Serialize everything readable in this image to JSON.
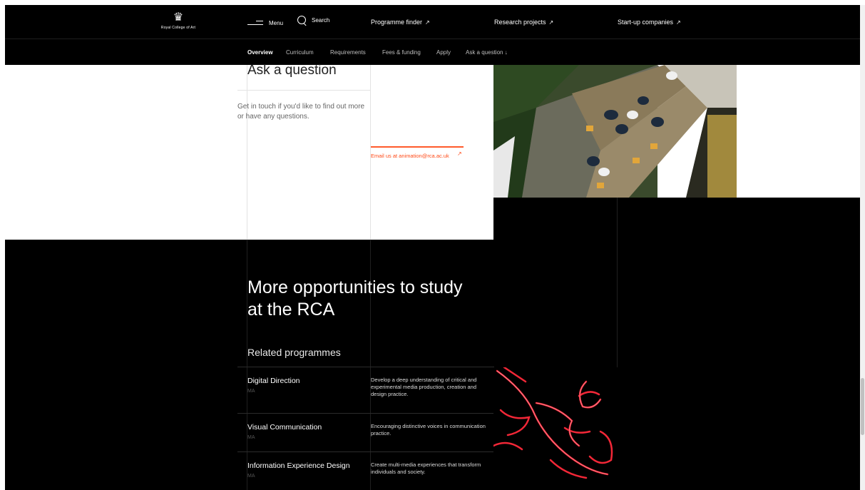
{
  "header": {
    "logo_text": "Royal College of Art",
    "menu_label": "Menu",
    "search_label": "Search",
    "links": [
      {
        "label": "Programme finder",
        "arrow": "↗"
      },
      {
        "label": "Research projects",
        "arrow": "↗"
      },
      {
        "label": "Start-up companies",
        "arrow": "↗"
      }
    ]
  },
  "subnav": {
    "items": [
      "Overview",
      "Curriculum",
      "Requirements",
      "Fees & funding",
      "Apply",
      "Ask a question ↓"
    ],
    "active": "Overview"
  },
  "ask": {
    "title": "Ask a question",
    "text": "Get in touch if you'd like to find out more or have any questions.",
    "email_link": "Email us at animation@rca.ac.uk",
    "email_arrow": "↗"
  },
  "opportunities": {
    "title": "More opportunities to study at the RCA",
    "related_heading": "Related programmes",
    "programmes": [
      {
        "name": "Digital Direction",
        "degree": "MA",
        "description": "Develop a deep understanding of critical and experimental media production, creation and design practice."
      },
      {
        "name": "Visual Communication",
        "degree": "MA",
        "description": "Encouraging distinctive voices in communication practice."
      },
      {
        "name": "Information Experience Design",
        "degree": "MA",
        "description": "Create multi-media experiences that transform individuals and society."
      }
    ]
  },
  "colors": {
    "accent": "#ff4a17",
    "background_dark": "#000000",
    "neon": "#ff2a3a"
  }
}
